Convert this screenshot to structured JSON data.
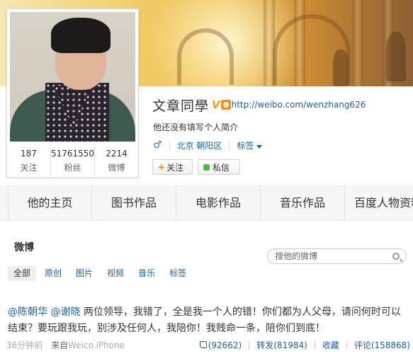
{
  "profile": {
    "name": "文章同學",
    "verified_mark": "V",
    "url": "http://weibo.com/wenzhang626",
    "bio": "他还没有填写个人简介",
    "gender_icon": "♂",
    "location": "北京 朝阳区",
    "tags_label": "标签",
    "follow_label": "关注",
    "message_label": "私信"
  },
  "stats": [
    {
      "num": "187",
      "label": "关注"
    },
    {
      "num": "51761550",
      "label": "粉丝"
    },
    {
      "num": "2214",
      "label": "微博"
    }
  ],
  "tabs": [
    "他的主页",
    "图书作品",
    "电影作品",
    "音乐作品",
    "百度人物资料"
  ],
  "weibo": {
    "title": "微博",
    "search_placeholder": "搜他的微博",
    "filters": [
      "全部",
      "原创",
      "图片",
      "视频",
      "音乐",
      "标签"
    ]
  },
  "post": {
    "mention1": "@陈朝华",
    "mention2": "@谢晓",
    "text": " 两位领导，我错了，全是我一个人的错！你们都为人父母，请问何时可以结束？要玩跟我玩，别涉及任何人，我陪你！我贱命一条，陪你们到底！",
    "time": "36分钟前",
    "from": "来自",
    "client": "Weico.iPhone",
    "likes": "(92662)",
    "repost": "转发(81984)",
    "fav": "收藏",
    "comment": "评论(158868)"
  },
  "colors": {
    "link": "#1f5f99",
    "verified": "#e9a312",
    "follow_plus": "#f08a1c"
  }
}
